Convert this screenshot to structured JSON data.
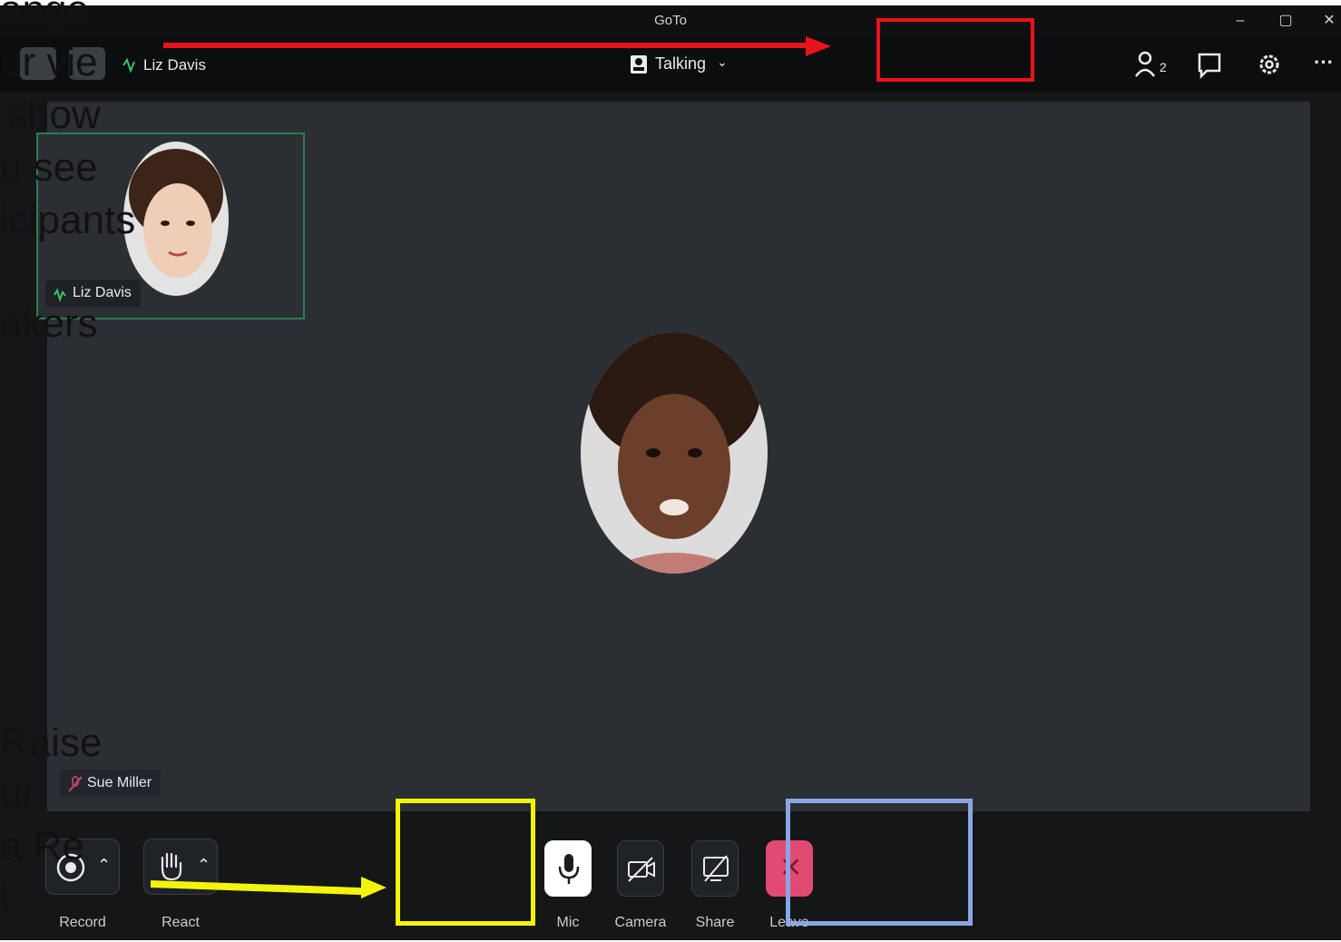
{
  "window": {
    "title": "GoTo"
  },
  "toolbar": {
    "active_speaker": "Liz Davis",
    "view_mode": "Talking",
    "participant_count": "2"
  },
  "participants": {
    "thumbnail_name": "Liz Davis",
    "muted_name": "Sue Miller"
  },
  "controls": {
    "record": "Record",
    "react": "React",
    "mic": "Mic",
    "camera": "Camera",
    "share": "Share",
    "leave": "Leave"
  },
  "overlay_text": {
    "l1": "ange",
    "l2": "ur vie",
    "l3": "show",
    "l4": "u see",
    "l5": "icipants",
    "l6": "akers",
    "l7": "Raise",
    "l8": "ur",
    "l9": "a Re",
    "l10": "t"
  },
  "annotation_colors": {
    "red": "#e8141a",
    "yellow": "#f4f40a",
    "blue": "#8aa6e0"
  }
}
